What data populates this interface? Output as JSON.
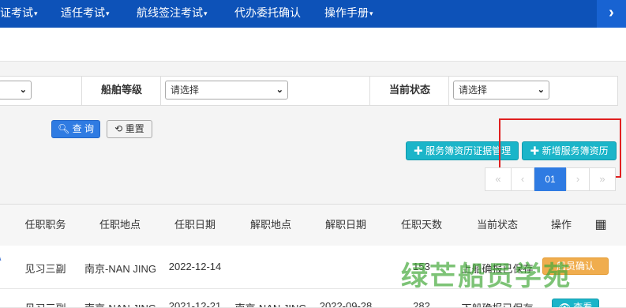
{
  "nav": {
    "items": [
      {
        "label": "证考试",
        "caret": "▾"
      },
      {
        "label": "适任考试",
        "caret": "▾"
      },
      {
        "label": "航线签注考试",
        "caret": "▾"
      },
      {
        "label": "代办委托确认",
        "caret": ""
      },
      {
        "label": "操作手册",
        "caret": "▾"
      }
    ],
    "arrow": "›"
  },
  "filter": {
    "first_select_value": "",
    "grade_label": "船舶等级",
    "grade_value": "请选择",
    "status_label": "当前状态",
    "status_value": "请选择"
  },
  "actions": {
    "query": "查 询",
    "reset": "重置",
    "evidence": "服务簿资历证据管理",
    "add": "新增服务簿资历"
  },
  "pager": {
    "prev_first": "«",
    "prev": "‹",
    "current": "01",
    "next": "›",
    "last": "»"
  },
  "table": {
    "headers": [
      "任职职务",
      "任职地点",
      "任职日期",
      "解职地点",
      "解职日期",
      "任职天数",
      "当前状态",
      "操作"
    ],
    "rows": [
      {
        "position": "见习三副",
        "place": "南京-NAN JING",
        "start": "2022-12-14",
        "end_place": "",
        "end_date": "",
        "days": "153",
        "status": "上船确报已保存",
        "action": "船员确认"
      },
      {
        "position": "见习三副",
        "place": "南京-NAN JING",
        "start": "2021-12-21",
        "end_place": "南京-NAN JING",
        "end_date": "2022-09-28",
        "days": "282",
        "status": "下船确报已保存",
        "action": "查看"
      }
    ]
  },
  "watermark": "绿芒船员学苑"
}
